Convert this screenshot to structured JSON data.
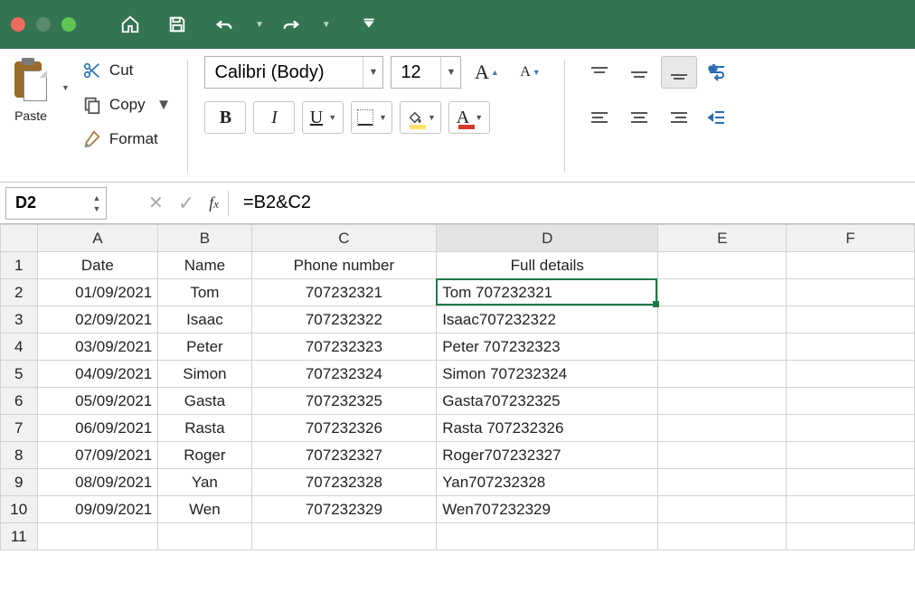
{
  "titlebar": {
    "home_icon": "home",
    "save_icon": "save",
    "undo_icon": "undo",
    "redo_icon": "redo"
  },
  "clipboard": {
    "paste_label": "Paste",
    "cut_label": "Cut",
    "copy_label": "Copy",
    "format_label": "Format"
  },
  "font": {
    "name": "Calibri (Body)",
    "size": "12"
  },
  "formula_bar": {
    "cell_ref": "D2",
    "formula": "=B2&C2"
  },
  "columns": [
    "A",
    "B",
    "C",
    "D",
    "E",
    "F"
  ],
  "header_row": {
    "A": "Date",
    "B": "Name",
    "C": "Phone number",
    "D": "Full details"
  },
  "rows": [
    {
      "n": "1",
      "A": "Date",
      "B": "Name",
      "C": "Phone number",
      "D": "Full details",
      "align": {
        "A": "center",
        "B": "center",
        "C": "center",
        "D": "center"
      }
    },
    {
      "n": "2",
      "A": "01/09/2021",
      "B": "Tom",
      "C": "707232321",
      "D": "Tom 707232321",
      "align": {
        "A": "right",
        "B": "center",
        "C": "center",
        "D": "left"
      }
    },
    {
      "n": "3",
      "A": "02/09/2021",
      "B": "Isaac",
      "C": "707232322",
      "D": "Isaac707232322",
      "align": {
        "A": "right",
        "B": "center",
        "C": "center",
        "D": "left"
      }
    },
    {
      "n": "4",
      "A": "03/09/2021",
      "B": "Peter",
      "C": "707232323",
      "D": "Peter 707232323",
      "align": {
        "A": "right",
        "B": "center",
        "C": "center",
        "D": "left"
      }
    },
    {
      "n": "5",
      "A": "04/09/2021",
      "B": "Simon",
      "C": "707232324",
      "D": "Simon 707232324",
      "align": {
        "A": "right",
        "B": "center",
        "C": "center",
        "D": "left"
      }
    },
    {
      "n": "6",
      "A": "05/09/2021",
      "B": "Gasta",
      "C": "707232325",
      "D": "Gasta707232325",
      "align": {
        "A": "right",
        "B": "center",
        "C": "center",
        "D": "left"
      }
    },
    {
      "n": "7",
      "A": "06/09/2021",
      "B": "Rasta",
      "C": "707232326",
      "D": "Rasta 707232326",
      "align": {
        "A": "right",
        "B": "center",
        "C": "center",
        "D": "left"
      }
    },
    {
      "n": "8",
      "A": "07/09/2021",
      "B": "Roger",
      "C": "707232327",
      "D": "Roger707232327",
      "align": {
        "A": "right",
        "B": "center",
        "C": "center",
        "D": "left"
      }
    },
    {
      "n": "9",
      "A": "08/09/2021",
      "B": "Yan",
      "C": "707232328",
      "D": "Yan707232328",
      "align": {
        "A": "right",
        "B": "center",
        "C": "center",
        "D": "left"
      }
    },
    {
      "n": "10",
      "A": "09/09/2021",
      "B": "Wen",
      "C": "707232329",
      "D": "Wen707232329",
      "align": {
        "A": "right",
        "B": "center",
        "C": "center",
        "D": "left"
      }
    },
    {
      "n": "11",
      "A": "",
      "B": "",
      "C": "",
      "D": "",
      "align": {}
    }
  ],
  "selection": {
    "col": "D",
    "row": "2"
  }
}
